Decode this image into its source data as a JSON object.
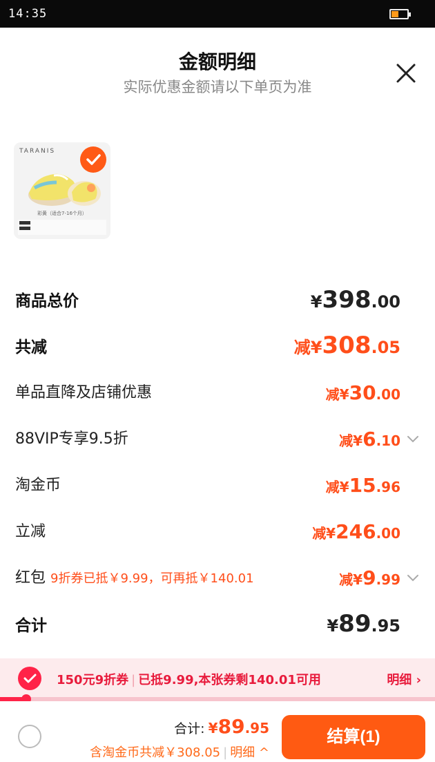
{
  "status_bar": {
    "time": "14:35"
  },
  "sheet": {
    "title": "金额明细",
    "subtitle": "实际优惠金额请以下单页为准"
  },
  "product": {
    "brand": "TARANIS",
    "caption": "彩黄（适合7-16个月）",
    "selected": true
  },
  "rows": {
    "total_price": {
      "label": "商品总价",
      "prefix": "¥",
      "int": "398",
      "dec": ".00"
    },
    "total_discount": {
      "label": "共减",
      "prefix": "减¥",
      "int": "308",
      "dec": ".05"
    },
    "store_discount": {
      "label": "单品直降及店铺优惠",
      "prefix": "减¥",
      "int": "30",
      "dec": ".00"
    },
    "vip_discount": {
      "label": "88VIP专享9.5折",
      "prefix": "减¥",
      "int": "6",
      "dec": ".10"
    },
    "coins": {
      "label": "淘金币",
      "prefix": "减¥",
      "int": "15",
      "dec": ".96"
    },
    "instant": {
      "label": "立减",
      "prefix": "减¥",
      "int": "246",
      "dec": ".00"
    },
    "redpacket": {
      "label": "红包",
      "note": "9折券已抵￥9.99，可再抵￥140.01",
      "prefix": "减¥",
      "int": "9",
      "dec": ".99"
    },
    "subtotal": {
      "label": "合计",
      "prefix": "¥",
      "int": "89",
      "dec": ".95"
    }
  },
  "coupon_bar": {
    "name": "150元9折券",
    "status": "已抵9.99,本张券剩140.01可用",
    "detail": "明细 ›",
    "progress": 0.06
  },
  "bottom_bar": {
    "total_label": "合计:",
    "total_prefix": "¥",
    "total_int": "89",
    "total_dec": ".95",
    "saving_text": "含淘金币共减￥308.05",
    "saving_detail": "明细 ^",
    "checkout_label": "结算(1)"
  },
  "colors": {
    "accent": "#ff4e1a",
    "coupon_red": "#e81b3c",
    "checkout_orange": "#ff5a12"
  }
}
